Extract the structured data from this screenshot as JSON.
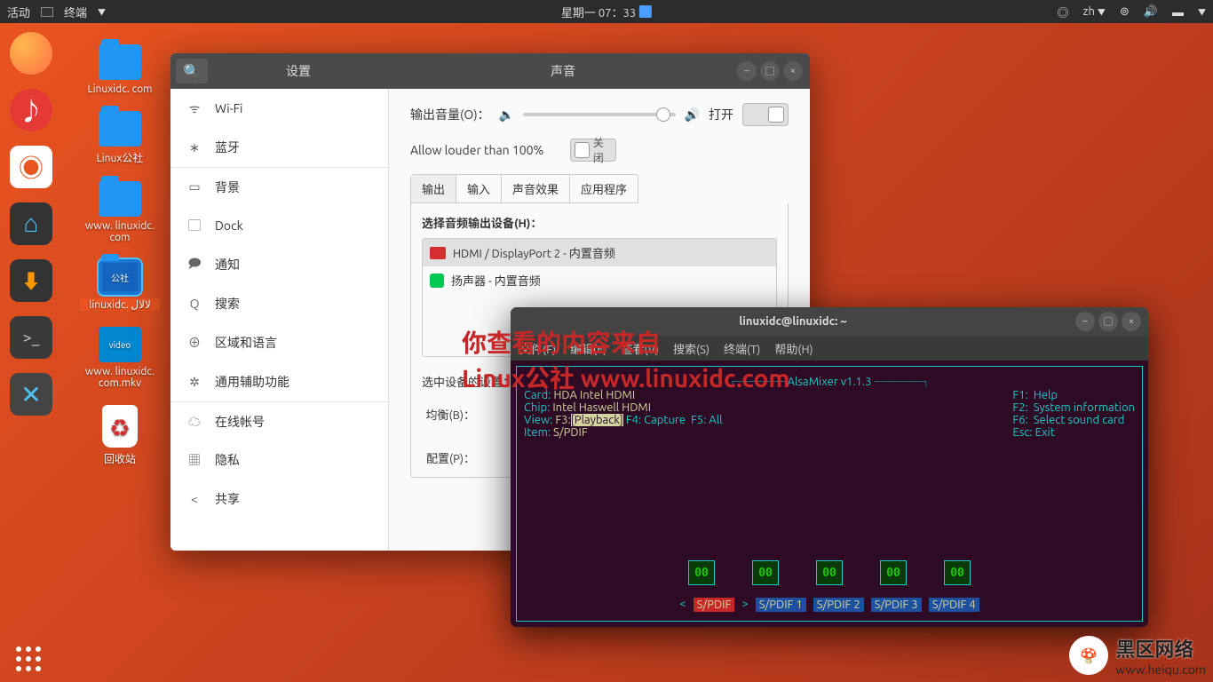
{
  "topbar": {
    "activities": "活动",
    "app": "终端",
    "clock": "星期一 07：33",
    "lang": "zh"
  },
  "desktop": {
    "icons": [
      "Linuxidc. com",
      "Linux公社",
      "www. linuxidc. com",
      "linuxidc. لالال",
      "www. linuxidc. com.mkv",
      "回收站"
    ]
  },
  "settings": {
    "sidebar_title": "设置",
    "content_title": "声音",
    "items": [
      "Wi-Fi",
      "蓝牙",
      "背景",
      "Dock",
      "通知",
      "搜索",
      "区域和语言",
      "通用辅助功能",
      "在线帐号",
      "隐私",
      "共享"
    ],
    "output_volume": "输出音量(O)：",
    "open_label": "打开",
    "louder": "Allow louder than 100%",
    "close_label": "关闭",
    "tabs": [
      "输出",
      "输入",
      "声音效果",
      "应用程序"
    ],
    "choose_device": "选择音频输出设备(H)：",
    "devices": [
      "HDMI / DisplayPort 2 - 内置音频",
      "扬声器 - 内置音频"
    ],
    "selected_settings": "选中设备的设置：",
    "balance": "均衡(B)：",
    "profile": "配置(P)："
  },
  "terminal": {
    "title": "linuxidc@linuxidc: ~",
    "menu": [
      "文件(F)",
      "编辑(E)",
      "查看(V)",
      "搜索(S)",
      "终端(T)",
      "帮助(H)"
    ],
    "mixer_title": "AlsaMixer v1.1.3",
    "left": {
      "card_k": "Card:",
      "card_v": "HDA Intel HDMI",
      "chip_k": "Chip:",
      "chip_v": "Intel Haswell HDMI",
      "view_k": "View:",
      "view_v1": "F3:",
      "view_v2": "[Playback]",
      "view_v3": "F4: Capture  F5: All",
      "item_k": "Item:",
      "item_v": "S/PDIF"
    },
    "right": {
      "f1": "F1:  Help",
      "f2": "F2:  System information",
      "f6": "F6:  Select sound card",
      "esc": "Esc: Exit"
    },
    "levels": [
      "00",
      "00",
      "00",
      "00",
      "00"
    ],
    "labels": [
      "S/PDIF",
      "S/PDIF 1",
      "S/PDIF 2",
      "S/PDIF 3",
      "S/PDIF 4"
    ]
  },
  "watermark": {
    "line1": "你查看的内容来自",
    "line2": "Linux公社 www.linuxidc.com",
    "brand": "黑区网络",
    "url": "www.heiqu.com"
  }
}
